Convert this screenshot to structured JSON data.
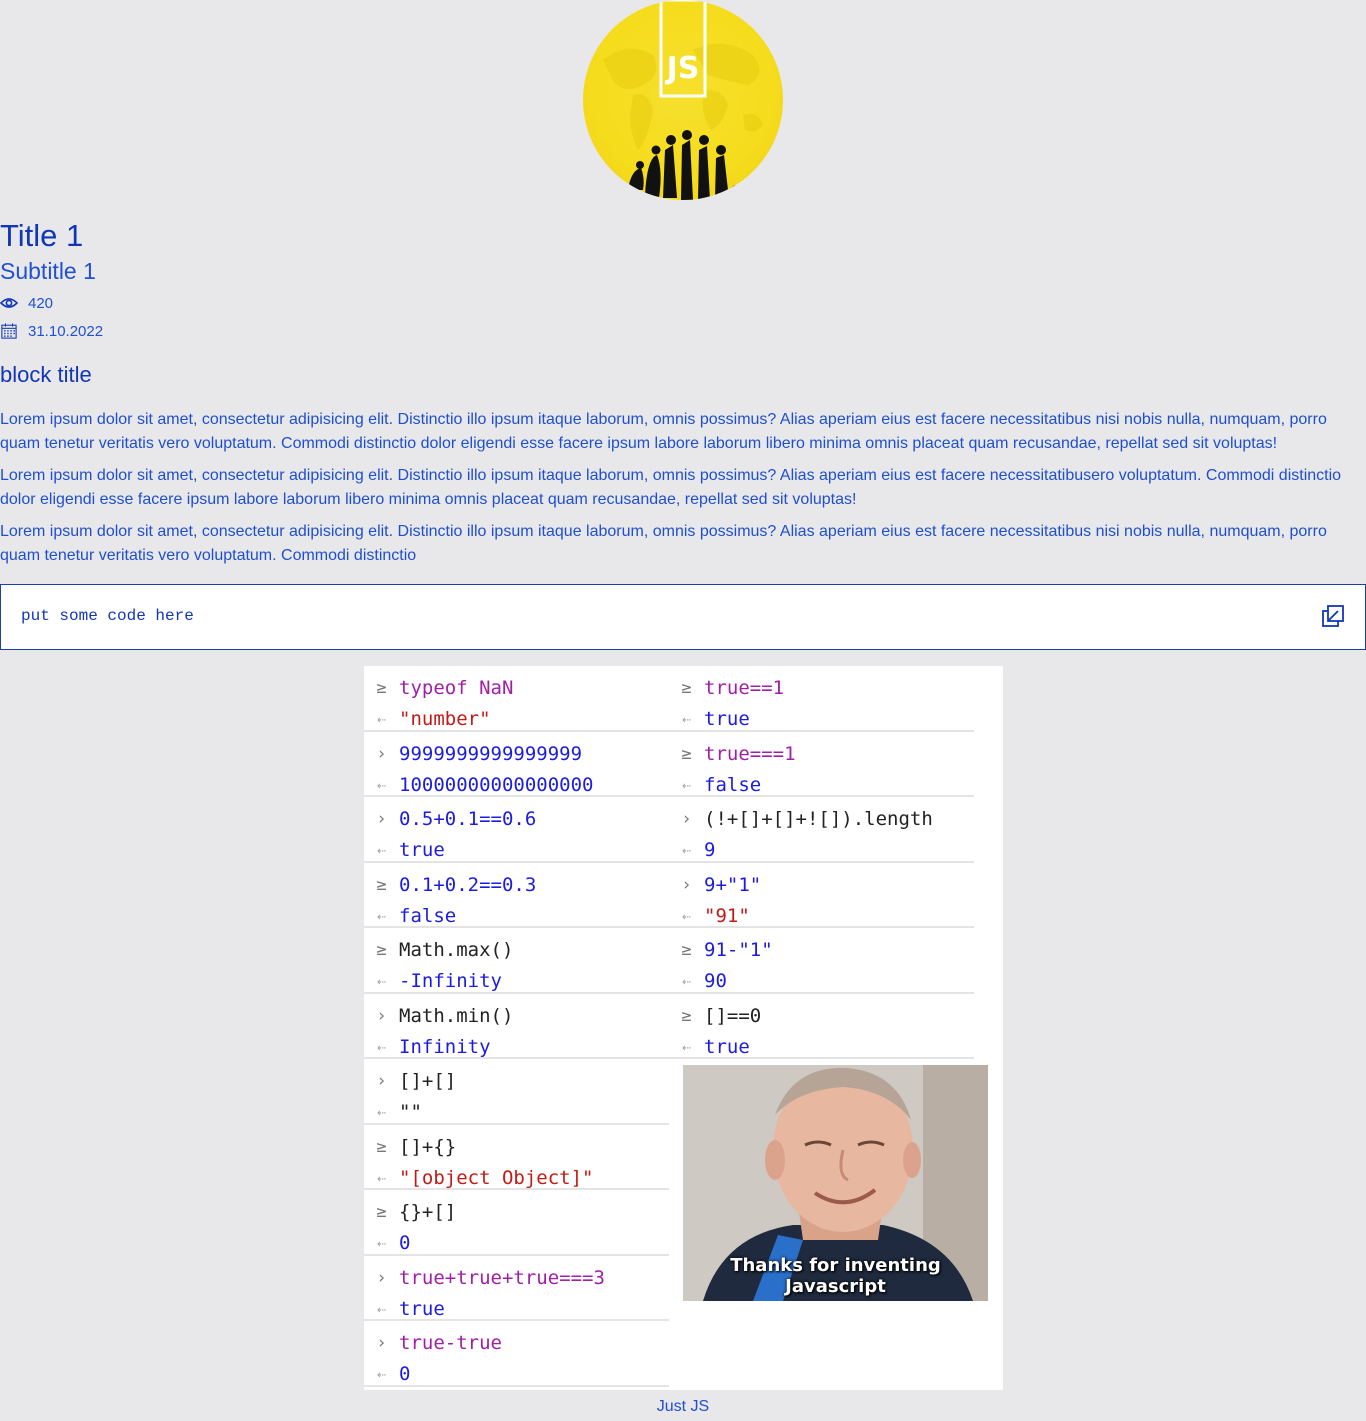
{
  "logo": {
    "text": "JS"
  },
  "article": {
    "title": "Title 1",
    "subtitle": "Subtitle 1",
    "views": "420",
    "date": "31.10.2022",
    "block_title": "block title",
    "paragraphs": [
      "Lorem ipsum dolor sit amet, consectetur adipisicing elit. Distinctio illo ipsum itaque laborum, omnis possimus? Alias aperiam eius est facere necessitatibus nisi nobis nulla, numquam, porro quam tenetur veritatis vero voluptatum. Commodi distinctio dolor eligendi esse facere ipsum labore laborum libero minima omnis placeat quam recusandae, repellat sed sit voluptas!",
      "Lorem ipsum dolor sit amet, consectetur adipisicing elit. Distinctio illo ipsum itaque laborum, omnis possimus? Alias aperiam eius est facere necessitatibusero voluptatum. Commodi distinctio dolor eligendi esse facere ipsum labore laborum libero minima omnis placeat quam recusandae, repellat sed sit voluptas!",
      "Lorem ipsum dolor sit amet, consectetur adipisicing elit. Distinctio illo ipsum itaque laborum, omnis possimus? Alias aperiam eius est facere necessitatibus nisi nobis nulla, numquam, porro quam tenetur veritatis vero voluptatum. Commodi distinctio"
    ]
  },
  "code_block": {
    "code": "put some code here"
  },
  "console": {
    "left": [
      {
        "input": "typeof NaN",
        "output": "\"number\""
      },
      {
        "input": "9999999999999999",
        "output": "10000000000000000"
      },
      {
        "input": "0.5+0.1==0.6",
        "output": "true"
      },
      {
        "input": "0.1+0.2==0.3",
        "output": "false"
      },
      {
        "input": "Math.max()",
        "output": "-Infinity"
      },
      {
        "input": "Math.min()",
        "output": "Infinity"
      },
      {
        "input": "[]+[]",
        "output": "\"\""
      },
      {
        "input": "[]+{}",
        "output": "\"[object Object]\""
      },
      {
        "input": "{}+[]",
        "output": "0"
      },
      {
        "input": "true+true+true===3",
        "output": "true"
      },
      {
        "input": "true-true",
        "output": "0"
      }
    ],
    "right": [
      {
        "input": "true==1",
        "output": "true"
      },
      {
        "input": "true===1",
        "output": "false"
      },
      {
        "input": "(!+[]+[]+![]).length",
        "output": "9"
      },
      {
        "input": "9+\"1\"",
        "output": "\"91\""
      },
      {
        "input": "91-\"1\"",
        "output": "90"
      },
      {
        "input": "[]==0",
        "output": "true"
      }
    ],
    "meme_caption": "Thanks for inventing Javascript"
  },
  "footer": {
    "text": "Just JS"
  }
}
